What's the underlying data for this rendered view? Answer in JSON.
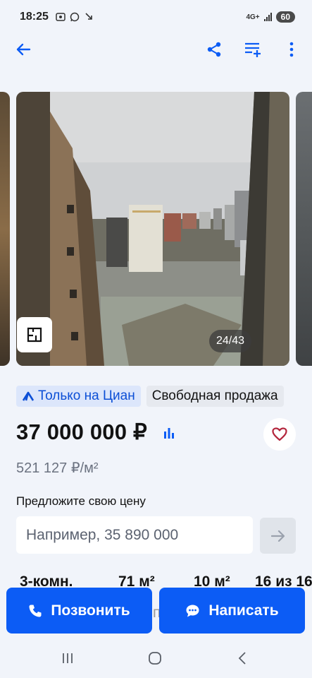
{
  "status_bar": {
    "time": "18:25",
    "network": "4G+",
    "battery": "60"
  },
  "gallery": {
    "counter": "24/43"
  },
  "badges": {
    "cian_only": "Только на Циан",
    "sale_type": "Свободная продажа"
  },
  "price": {
    "total": "37 000 000 ₽",
    "per_m2": "521 127 ₽/м²"
  },
  "offer": {
    "label": "Предложите свою цену",
    "placeholder": "Например, 35 890 000"
  },
  "params": [
    "3-комн.",
    "71 м²",
    "10 м²",
    "16 из 16"
  ],
  "actions": {
    "call_label": "Позвонить",
    "message_label": "Написать",
    "behind_text": "п"
  },
  "colors": {
    "accent": "#0c5cf5",
    "heart": "#b3243b",
    "background": "#f1f4fa"
  },
  "icons": [
    "back-arrow-icon",
    "share-icon",
    "add-to-list-icon",
    "more-vert-icon",
    "floorplan-icon",
    "price-chart-icon",
    "heart-icon",
    "arrow-right-icon",
    "phone-icon",
    "chat-icon"
  ]
}
